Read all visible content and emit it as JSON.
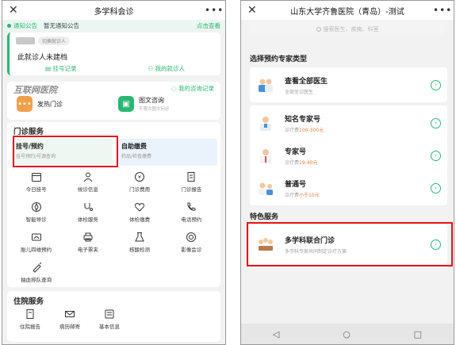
{
  "left": {
    "header": {
      "close": "✕",
      "title": "多学科会诊",
      "more": "•••"
    },
    "notice": {
      "label": "通知公告",
      "text": "暂无通知公告",
      "link": "点击查看"
    },
    "patient": {
      "switch": "切换就诊人",
      "message": "此就诊人未建档",
      "links": [
        "挂号记录",
        "我的就诊人"
      ]
    },
    "consult": {
      "brand": "互联网医院",
      "records": "我的咨询记录",
      "services": [
        {
          "title": "发热门诊",
          "sub": ""
        },
        {
          "title": "图文咨询",
          "sub": "不限次图文问诊"
        }
      ]
    },
    "outpatient": {
      "title": "门诊服务",
      "banners": [
        {
          "title": "挂号/预约",
          "sub": "挂号预约/号源查询"
        },
        {
          "title": "自助缴费",
          "sub": "药品/检查缴费"
        }
      ],
      "items": [
        "今日挂号",
        "候诊信息",
        "门诊费用",
        "门诊报告",
        "智能导诊",
        "体检服务",
        "体检缴费",
        "电话预约",
        "胎儿四维预约",
        "电子票夹",
        "核酸检测",
        "影像会诊",
        "抽血排队查询"
      ]
    },
    "inpatient": {
      "title": "住院服务",
      "items": [
        "住院报告",
        "病历邮寄",
        "基本信息"
      ]
    }
  },
  "right": {
    "header": {
      "close": "✕",
      "title": "山东大学齐鲁医院（青岛）-测试",
      "more": "•••"
    },
    "search_placeholder": "搜索医生、疾病、科室",
    "section1": "选择预约专家类型",
    "options": [
      {
        "name": "查看全部医生",
        "sub": "全部坐诊医生",
        "price": ""
      },
      {
        "name": "知名专家号",
        "sub": "诊疗费",
        "price": "100-300元"
      },
      {
        "name": "专家号",
        "sub": "诊疗费",
        "price": "19-40元"
      },
      {
        "name": "普通号",
        "sub": "诊疗费",
        "price": "小于10元"
      }
    ],
    "section2": "特色服务",
    "special": {
      "name": "多学科联合门诊",
      "sub": "多学科专家共同制定诊疗方案"
    },
    "nav": [
      "◁",
      "○",
      "□"
    ]
  },
  "colors": {
    "accent": "#2bb673",
    "highlight_border": "#e0161b",
    "price": "#f07a3a"
  }
}
